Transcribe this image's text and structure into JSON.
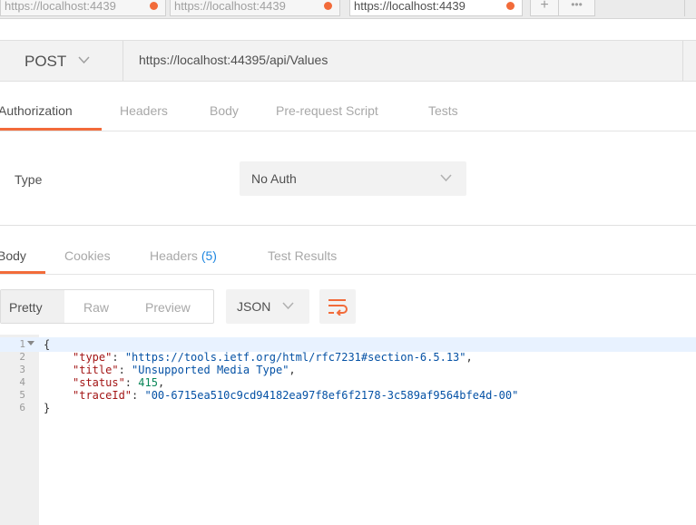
{
  "tabs": [
    {
      "label": "https://localhost:4439",
      "active": false
    },
    {
      "label": "https://localhost:4439",
      "active": false
    },
    {
      "label": "https://localhost:4439",
      "active": true
    }
  ],
  "new_tab_label": "+",
  "more_tabs_label": "•••",
  "request": {
    "method": "POST",
    "url": "https://localhost:44395/api/Values"
  },
  "request_tabs": [
    "Authorization",
    "Headers",
    "Body",
    "Pre-request Script",
    "Tests"
  ],
  "auth": {
    "type_label": "Type",
    "type_value": "No Auth"
  },
  "response": {
    "tabs": {
      "body": "Body",
      "cookies": "Cookies",
      "headers": "Headers",
      "headers_count": "(5)",
      "test_results": "Test Results"
    },
    "format_buttons": [
      "Pretty",
      "Raw",
      "Preview"
    ],
    "language": "JSON",
    "line_numbers": [
      "1",
      "2",
      "3",
      "4",
      "5",
      "6"
    ],
    "body_lines": [
      {
        "open": "{"
      },
      {
        "key": "\"type\"",
        "value": "\"https://tools.ietf.org/html/rfc7231#section-6.5.13\"",
        "trail": ","
      },
      {
        "key": "\"title\"",
        "value": "\"Unsupported Media Type\"",
        "trail": ","
      },
      {
        "key": "\"status\"",
        "value": "415",
        "trail": ","
      },
      {
        "key": "\"traceId\"",
        "value": "\"00-6715ea510c9cd94182ea97f8ef6f2178-3c589af9564bfe4d-00\"",
        "trail": ""
      },
      {
        "close": "}"
      }
    ]
  },
  "colors": {
    "accent": "#f26b3a",
    "count": "#1f87e0"
  }
}
